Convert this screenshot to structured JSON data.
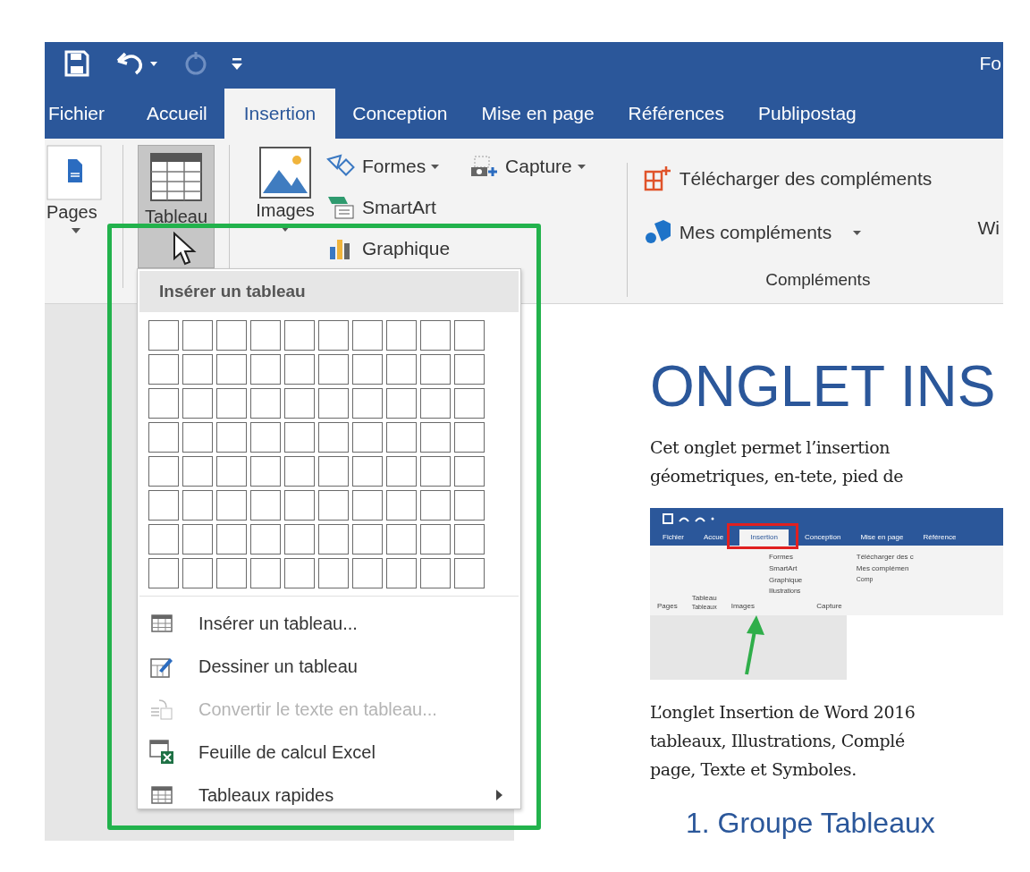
{
  "window": {
    "title": "Fo"
  },
  "tabs": [
    {
      "label": "Fichier",
      "selected": false
    },
    {
      "label": "Accueil",
      "selected": false
    },
    {
      "label": "Insertion",
      "selected": true
    },
    {
      "label": "Conception",
      "selected": false
    },
    {
      "label": "Mise en page",
      "selected": false
    },
    {
      "label": "Références",
      "selected": false
    },
    {
      "label": "Publipostag",
      "selected": false
    }
  ],
  "ribbon": {
    "pages": {
      "label": "Pages"
    },
    "tableau": {
      "label": "Tableau",
      "selected": true
    },
    "images": {
      "label": "Images"
    },
    "illustrations": [
      {
        "label": "Formes",
        "dropdown": true
      },
      {
        "label": "SmartArt",
        "dropdown": false
      },
      {
        "label": "Graphique",
        "dropdown": false
      }
    ],
    "capture": {
      "label": "Capture",
      "dropdown": true
    },
    "addins": [
      {
        "label": "Télécharger des compléments",
        "dropdown": false
      },
      {
        "label": "Mes compléments",
        "dropdown": true
      }
    ],
    "addins_group": "Compléments",
    "cut_label": "Wi"
  },
  "menu": {
    "header": "Insérer un tableau",
    "items": [
      {
        "label": "Insérer un tableau...",
        "kind": "table",
        "disabled": false,
        "submenu": false
      },
      {
        "label": "Dessiner un tableau",
        "kind": "draw",
        "disabled": false,
        "submenu": false
      },
      {
        "label": "Convertir le texte en tableau...",
        "kind": "convert",
        "disabled": true,
        "submenu": false
      },
      {
        "label": "Feuille de calcul Excel",
        "kind": "excel",
        "disabled": false,
        "submenu": false
      },
      {
        "label": "Tableaux rapides",
        "kind": "table",
        "disabled": false,
        "submenu": true
      }
    ]
  },
  "document": {
    "heading": "ONGLET INS",
    "intro_lines": [
      "Cet onglet permet l’insertion",
      "géometriques, en-tete, pied de"
    ],
    "inset": {
      "tabs": [
        {
          "label": "Fichier",
          "selected": false
        },
        {
          "label": "Accue",
          "selected": false
        },
        {
          "label": "Insertion",
          "selected": true
        },
        {
          "label": "Conception",
          "selected": false
        },
        {
          "label": "Mise en page",
          "selected": false
        },
        {
          "label": "Référence",
          "selected": false
        }
      ],
      "labels": {
        "pages": "Pages",
        "tableau": "Tableau",
        "images": "Images",
        "formes": "Formes",
        "capture": "Capture",
        "smartart": "SmartArt",
        "graphique": "Graphique",
        "tableaux": "Tableaux",
        "illustrations": "Illustrations",
        "telecharger": "Télécharger des c",
        "mes": "Mes complémen",
        "comp": "Comp"
      }
    },
    "body_lines": [
      "L’onglet Insertion de Word 2016",
      "tableaux, Illustrations, Complé",
      "page, Texte et Symboles."
    ],
    "subheading": "1. Groupe Tableaux"
  }
}
